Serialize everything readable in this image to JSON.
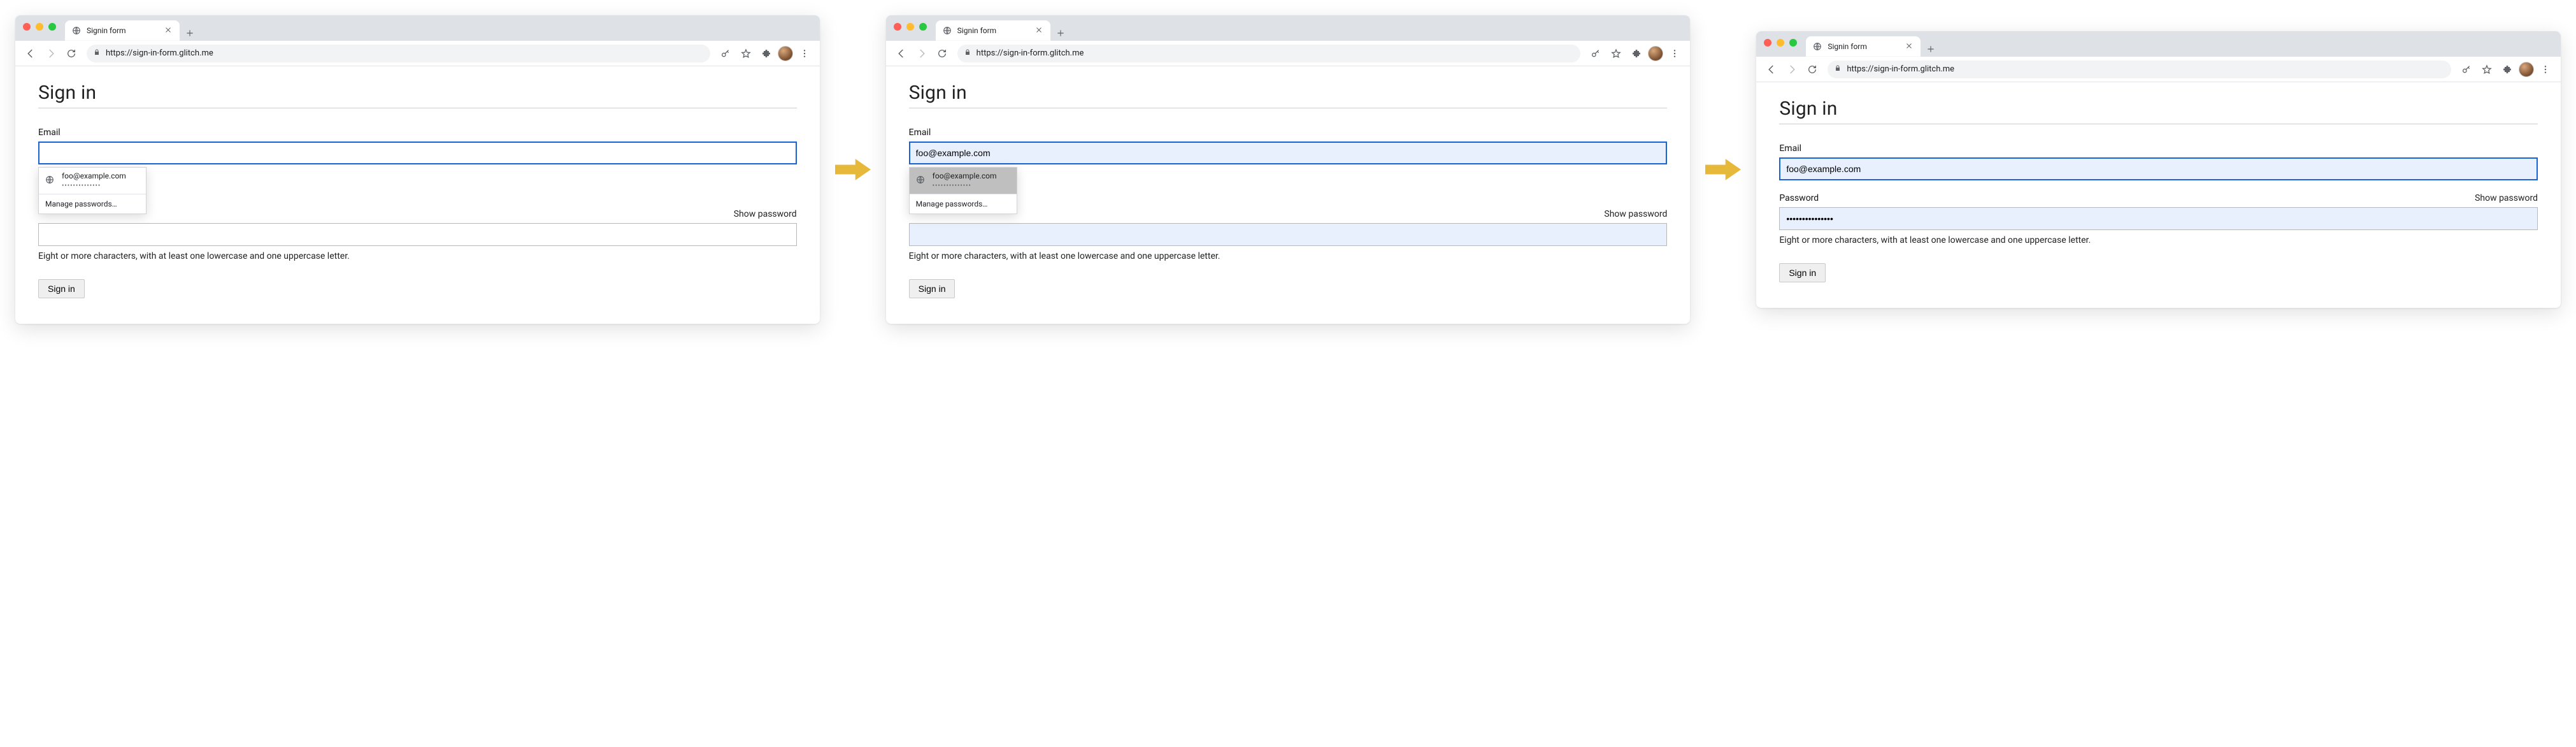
{
  "browser": {
    "tab_title": "Signin form",
    "url": "https://sign-in-form.glitch.me"
  },
  "page": {
    "heading": "Sign in",
    "email_label": "Email",
    "password_label": "Password",
    "show_password": "Show password",
    "password_hint": "Eight or more characters, with at least one lowercase and one uppercase letter.",
    "submit_label": "Sign in"
  },
  "autofill": {
    "email": "foo@example.com",
    "password_mask": "••••••••••••••",
    "manage_label": "Manage passwords…"
  },
  "states": {
    "a": {
      "email_value": "",
      "password_value": ""
    },
    "b": {
      "email_value": "foo@example.com",
      "password_value": ""
    },
    "c": {
      "email_value": "foo@example.com",
      "password_value": "•••••••••••••••"
    }
  }
}
